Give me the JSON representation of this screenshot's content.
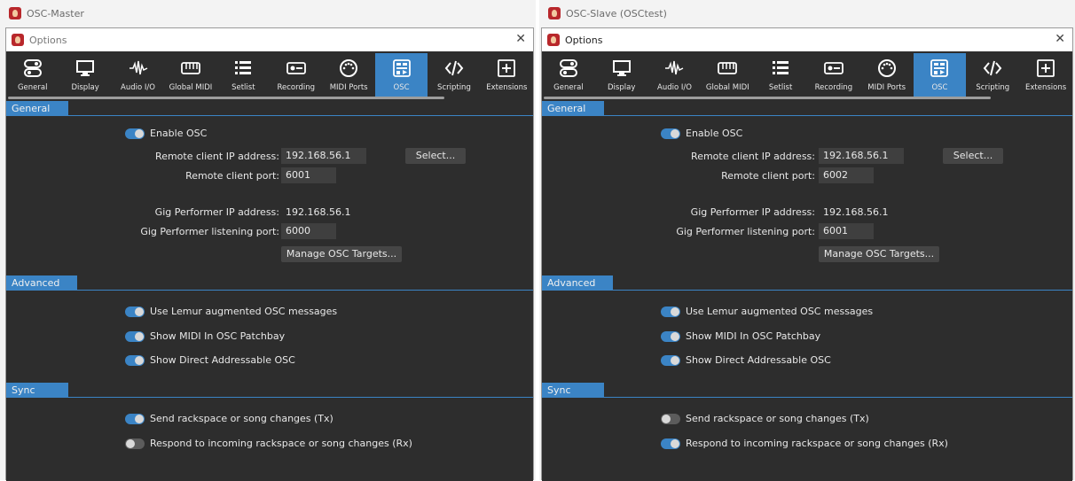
{
  "left": {
    "window_title": "OSC-Master",
    "dialog_title": "Options",
    "tabs": [
      {
        "label": "General",
        "icon": "toggles-icon"
      },
      {
        "label": "Display",
        "icon": "monitor-icon"
      },
      {
        "label": "Audio I/O",
        "icon": "waveform-icon"
      },
      {
        "label": "Global MIDI",
        "icon": "keyboard-icon"
      },
      {
        "label": "Setlist",
        "icon": "list-icon"
      },
      {
        "label": "Recording",
        "icon": "record-icon"
      },
      {
        "label": "MIDI Ports",
        "icon": "midi-port-icon"
      },
      {
        "label": "OSC",
        "icon": "osc-icon"
      },
      {
        "label": "Scripting",
        "icon": "code-icon"
      },
      {
        "label": "Extensions",
        "icon": "plus-box-icon"
      }
    ],
    "active_tab": "OSC",
    "general": {
      "header": "General",
      "enable_osc": {
        "label": "Enable OSC",
        "on": true
      },
      "remote_ip_label": "Remote client IP address:",
      "remote_ip_value": "192.168.56.1",
      "select_button": "Select...",
      "remote_port_label": "Remote client port:",
      "remote_port_value": "6001",
      "gp_ip_label": "Gig Performer IP address:",
      "gp_ip_value": "192.168.56.1",
      "gp_port_label": "Gig Performer listening port:",
      "gp_port_value": "6000",
      "manage_button": "Manage OSC Targets..."
    },
    "advanced": {
      "header": "Advanced",
      "lemur": {
        "label": "Use Lemur augmented OSC messages",
        "on": true
      },
      "midi_in": {
        "label": "Show MIDI In OSC Patchbay",
        "on": true
      },
      "direct": {
        "label": "Show Direct Addressable OSC",
        "on": true
      }
    },
    "sync": {
      "header": "Sync",
      "send": {
        "label": "Send rackspace or song changes (Tx)",
        "on": true
      },
      "respond": {
        "label": "Respond to incoming rackspace or song changes (Rx)",
        "on": false
      }
    }
  },
  "right": {
    "window_title": "OSC-Slave (OSCtest)",
    "dialog_title": "Options",
    "tabs": [
      {
        "label": "General",
        "icon": "toggles-icon"
      },
      {
        "label": "Display",
        "icon": "monitor-icon"
      },
      {
        "label": "Audio I/O",
        "icon": "waveform-icon"
      },
      {
        "label": "Global MIDI",
        "icon": "keyboard-icon"
      },
      {
        "label": "Setlist",
        "icon": "list-icon"
      },
      {
        "label": "Recording",
        "icon": "record-icon"
      },
      {
        "label": "MIDI Ports",
        "icon": "midi-port-icon"
      },
      {
        "label": "OSC",
        "icon": "osc-icon"
      },
      {
        "label": "Scripting",
        "icon": "code-icon"
      },
      {
        "label": "Extensions",
        "icon": "plus-box-icon"
      }
    ],
    "active_tab": "OSC",
    "general": {
      "header": "General",
      "enable_osc": {
        "label": "Enable OSC",
        "on": true
      },
      "remote_ip_label": "Remote client IP address:",
      "remote_ip_value": "192.168.56.1",
      "select_button": "Select...",
      "remote_port_label": "Remote client port:",
      "remote_port_value": "6002",
      "gp_ip_label": "Gig Performer IP address:",
      "gp_ip_value": "192.168.56.1",
      "gp_port_label": "Gig Performer listening port:",
      "gp_port_value": "6001",
      "manage_button": "Manage OSC Targets..."
    },
    "advanced": {
      "header": "Advanced",
      "lemur": {
        "label": "Use Lemur augmented OSC messages",
        "on": true
      },
      "midi_in": {
        "label": "Show MIDI In OSC Patchbay",
        "on": true
      },
      "direct": {
        "label": "Show Direct Addressable OSC",
        "on": true
      }
    },
    "sync": {
      "header": "Sync",
      "send": {
        "label": "Send rackspace or song changes (Tx)",
        "on": false
      },
      "respond": {
        "label": "Respond to incoming rackspace or song changes (Rx)",
        "on": true
      }
    }
  },
  "colors": {
    "accent": "#3b84c5",
    "panel": "#2d2d2d",
    "field": "#3f3f3f"
  }
}
